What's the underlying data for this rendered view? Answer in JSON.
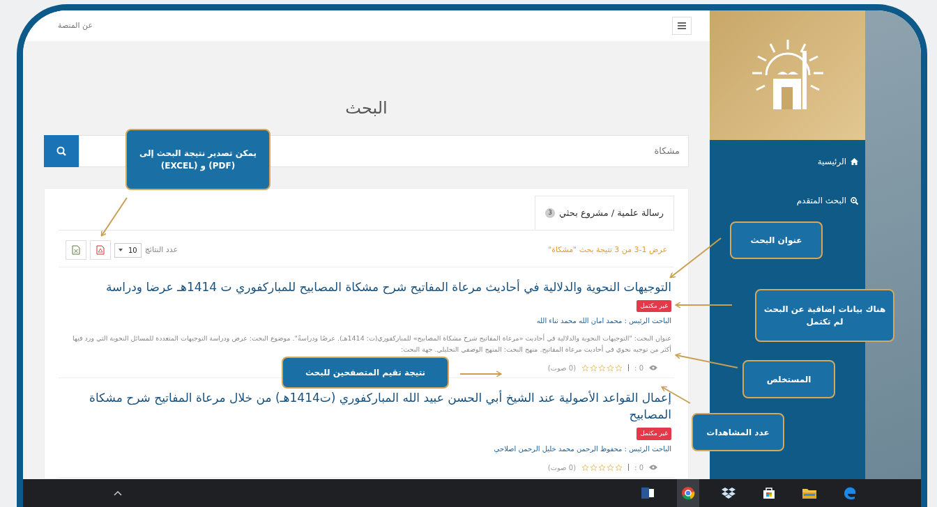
{
  "sidebar": {
    "items": [
      {
        "kind": "home",
        "label": "الرئيسية",
        "selected": false
      },
      {
        "kind": "search",
        "label": "البحث المتقدم",
        "selected": false
      }
    ]
  },
  "topbar": {
    "link": "عن المنصة"
  },
  "page_title": "البحث",
  "search": {
    "value": "مشكاة"
  },
  "tabs": [
    {
      "label": "رسالة علمية / مشروع بحثي",
      "count": "3",
      "selected": true
    }
  ],
  "results_summary": "عرض 1-3 من 3 نتيجة بحث \"مشكاة\"",
  "page_size": {
    "label": "عدد النتائج",
    "value": "10"
  },
  "results": [
    {
      "title": "التوجيهات النحوية والدلالية في أحاديث مرعاة المفاتيح شرح مشكاة المصابيح للمباركفوري ت 1414هـ عرضا ودراسة",
      "status": "غير مكتمل",
      "researcher": "الباحث الرئيس : محمد امان الله محمد ثناء الله",
      "abstract": "عنوان البحث: \"التوجيهات النحوية والدلالية في أحاديث «مرعاة المفاتيح شرح مشكاة المصابيح» للمباركفوري(ت: 1414هـ). عرضًا ودراسةً\". موضوع البحث: عرض ودراسة التوجيهات المتعددة للمسائل النحوية التي ورد فيها أكثر من توجيه نحوي في أحاديث مرعاة المفاتيح. منهج البحث: المنهج الوصفي التحليلي. جهة البحث:",
      "views": "0 :",
      "stars": 0,
      "votes": "(0 صوت)"
    },
    {
      "title": "إعمال القواعد الأصولية عند الشيخ أبي الحسن عبيد الله المباركفوري (ت1414هـ) من خلال مرعاة المفاتيح شرح مشكاة المصابيح",
      "status": "غير مكتمل",
      "researcher": "الباحث الرئيس : محفوظ الرحمن محمد خليل الرحمن اصلاحي",
      "views": "0 :",
      "stars": 0,
      "votes": "(0 صوت)"
    }
  ],
  "annotations": [
    {
      "text": "يمكن تصدير نتيجة البحث إلى (PDF) و (EXCEL)"
    },
    {
      "text": "عنوان البحث"
    },
    {
      "text": "هناك بيانات إضافية عن البحث لم تكتمل"
    },
    {
      "text": "المستخلص"
    },
    {
      "text": "عدد المشاهدات"
    },
    {
      "text": "نتيجة تقيم المتصفحين للبحث"
    }
  ]
}
